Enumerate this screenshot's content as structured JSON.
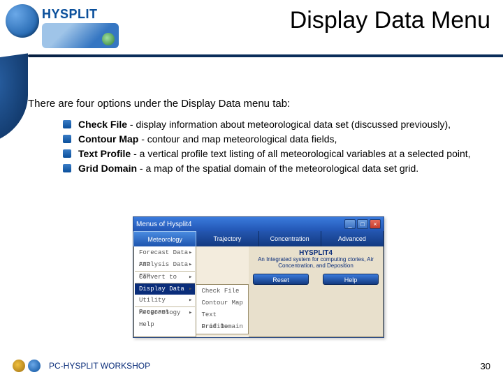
{
  "header": {
    "product_name": "HYSPLIT",
    "slide_title": "Display Data Menu"
  },
  "intro": "There are four options under the Display Data menu tab:",
  "bullets": [
    {
      "term": "Check File",
      "desc": " - display information about meteorological data set (discussed previously),"
    },
    {
      "term": "Contour Map",
      "desc": " - contour and map meteorological data fields,"
    },
    {
      "term": "Text Profile",
      "desc": " - a vertical profile text listing of all meteorological variables at a selected point,"
    },
    {
      "term": "Grid Domain",
      "desc": " - a map of the spatial domain of the meteorological data set grid."
    }
  ],
  "embedded_app": {
    "window_title": "Menus of Hysplit4",
    "menubar": [
      "Meteorology",
      "Trajectory",
      "Concentration",
      "Advanced"
    ],
    "side_menu": [
      "Forecast Data FTP",
      "Analysis Data FTP",
      "Convert to ARL",
      "Display Data",
      "Utility Programs",
      "Meteorology Help"
    ],
    "side_highlight_index": 3,
    "sub_menu": [
      "Check File",
      "Contour Map",
      "Text Profile",
      "Grid Domain"
    ],
    "panel_title": "HYSPLIT4",
    "panel_sub": "An Integrated system for computing ctories, Air Concentration, and Deposition",
    "buttons": {
      "reset": "Reset",
      "help": "Help"
    }
  },
  "footer": {
    "workshop": "PC-HYSPLIT WORKSHOP",
    "page": "30"
  }
}
